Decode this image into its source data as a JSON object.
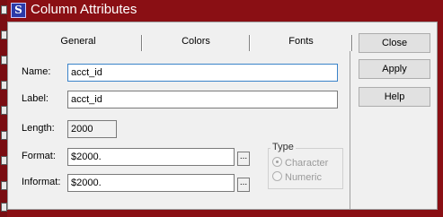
{
  "window": {
    "title": "Column Attributes",
    "icon": "sas-icon"
  },
  "tabs": [
    {
      "label": "General"
    },
    {
      "label": "Colors"
    },
    {
      "label": "Fonts"
    }
  ],
  "fields": {
    "name": {
      "label": "Name:",
      "value": "acct_id"
    },
    "label": {
      "label": "Label:",
      "value": "acct_id"
    },
    "length": {
      "label": "Length:",
      "value": "2000"
    },
    "format": {
      "label": "Format:",
      "value": "$2000."
    },
    "informat": {
      "label": "Informat:",
      "value": "$2000."
    },
    "browse_label": "..."
  },
  "type_group": {
    "title": "Type",
    "options": [
      {
        "label": "Character",
        "selected": true,
        "enabled": false
      },
      {
        "label": "Numeric",
        "selected": false,
        "enabled": false
      }
    ]
  },
  "buttons": {
    "close": "Close",
    "apply": "Apply",
    "help": "Help"
  },
  "colors": {
    "titlebar": "#8a0f14",
    "dialog_bg": "#f0f0f0",
    "focus_border": "#3a83c9"
  }
}
